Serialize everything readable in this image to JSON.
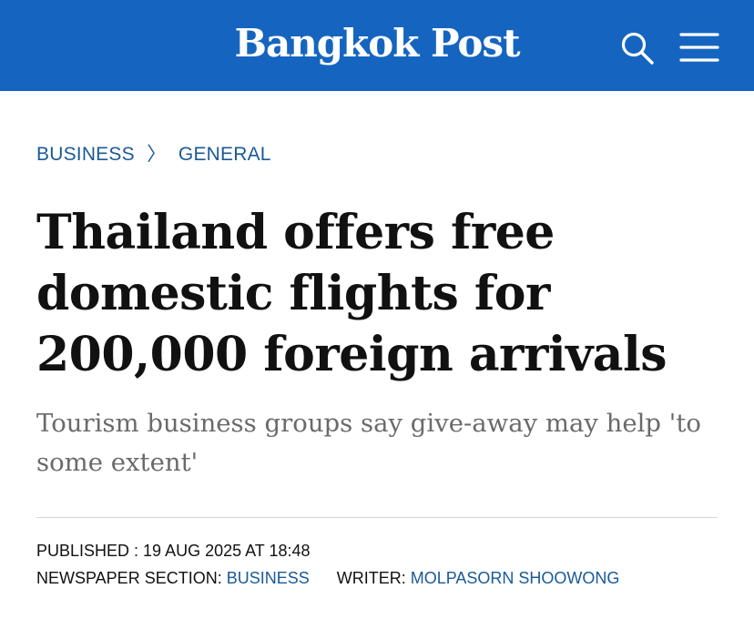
{
  "header": {
    "logo_text": "Bangkok Post",
    "search_icon": "search-icon",
    "menu_icon": "hamburger-menu-icon",
    "bar_color": "#1565C0"
  },
  "breadcrumb": {
    "items": [
      "BUSINESS",
      "GENERAL"
    ],
    "separator": "〉",
    "link_color": "#1a5a96"
  },
  "article": {
    "headline": "Thailand offers free domestic flights for 200,000 foreign arrivals",
    "subheadline": "Tourism business groups say give-away may help 'to some extent'",
    "published_label": "PUBLISHED : ",
    "published_value": "19 AUG 2025 AT 18:48",
    "section_label": "NEWSPAPER SECTION: ",
    "section_value": "BUSINESS",
    "writer_label": "WRITER: ",
    "writer_value": "MOLPASORN SHOOWONG"
  }
}
